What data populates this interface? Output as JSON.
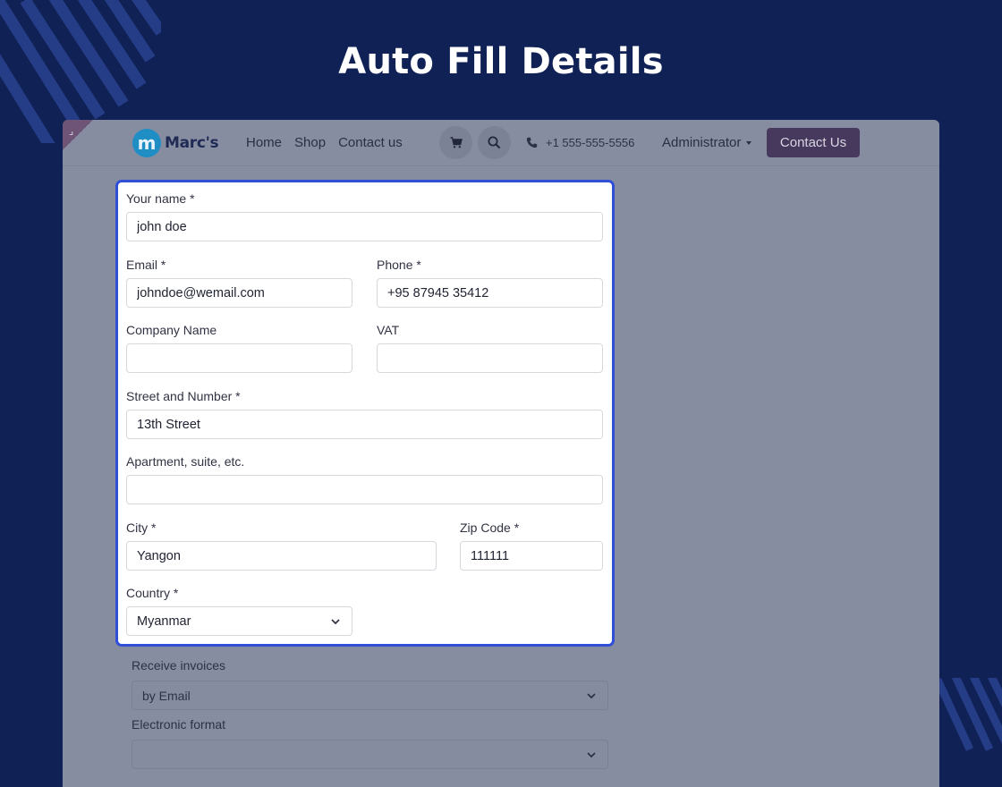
{
  "hero": {
    "title": "Auto Fill Details"
  },
  "navbar": {
    "logo_text": "Marc's",
    "logo_letter": "m",
    "links": [
      "Home",
      "Shop",
      "Contact us"
    ],
    "phone": "+1 555-555-5556",
    "user": "Administrator",
    "contact_button": "Contact Us"
  },
  "form": {
    "name": {
      "label": "Your name *",
      "value": "john doe"
    },
    "email": {
      "label": "Email *",
      "value": "johndoe@wemail.com"
    },
    "phone": {
      "label": "Phone *",
      "value": "+95 87945 35412"
    },
    "company": {
      "label": "Company Name",
      "value": ""
    },
    "vat": {
      "label": "VAT",
      "value": ""
    },
    "street": {
      "label": "Street and Number *",
      "value": "13th Street"
    },
    "apartment": {
      "label": "Apartment, suite, etc.",
      "value": ""
    },
    "city": {
      "label": "City *",
      "value": "Yangon"
    },
    "zip": {
      "label": "Zip Code *",
      "value": "111111"
    },
    "country": {
      "label": "Country *",
      "value": "Myanmar"
    }
  },
  "extra": {
    "invoices": {
      "label": "Receive invoices",
      "value": "by Email"
    },
    "format": {
      "label": "Electronic format",
      "value": ""
    }
  },
  "colors": {
    "background": "#102155",
    "highlight_border": "#2f4fd8",
    "contact_button": "#47395e"
  }
}
